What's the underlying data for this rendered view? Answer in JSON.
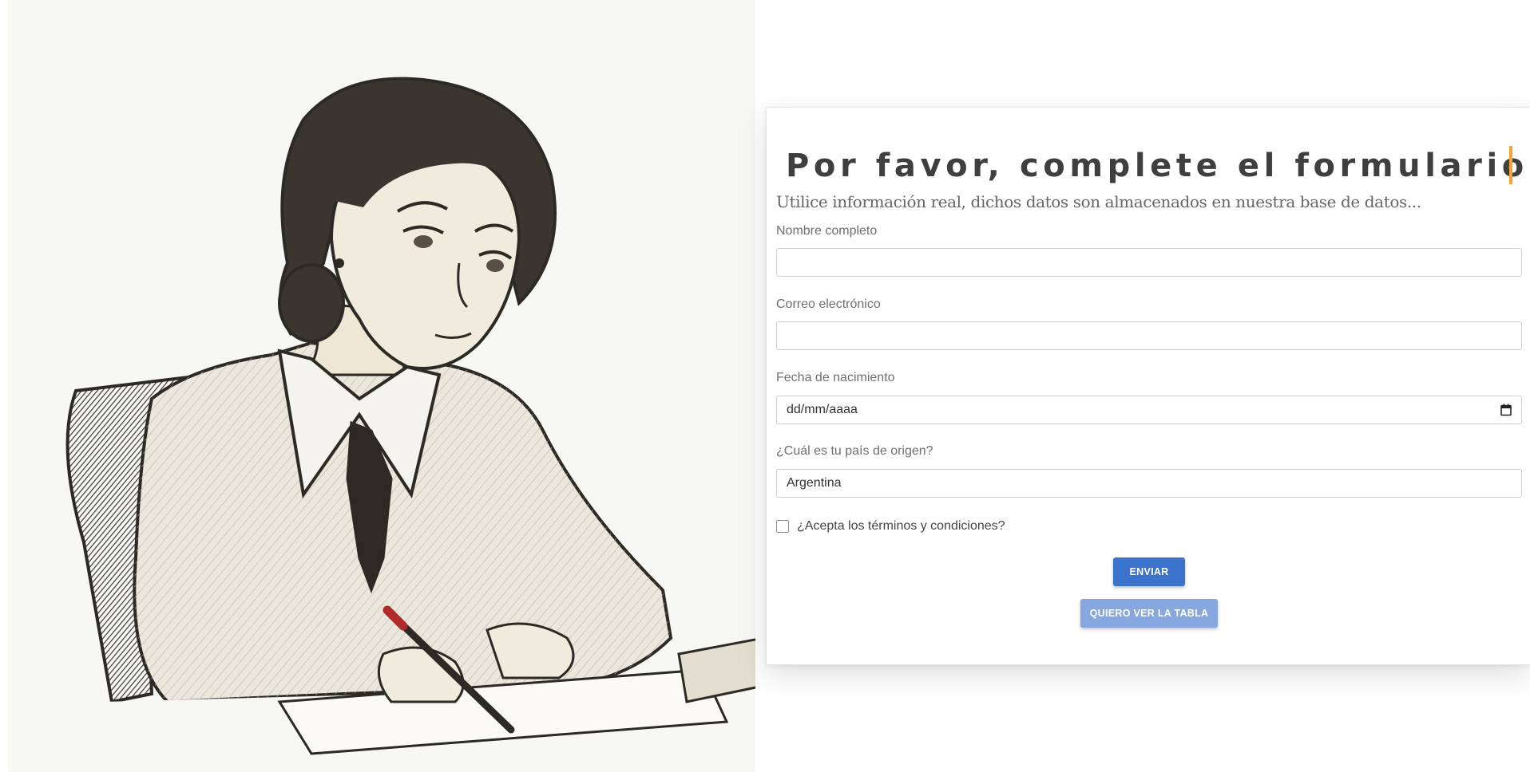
{
  "illustration": {
    "alt": "woman writing at desk"
  },
  "form": {
    "title": "Por favor, complete el formulario.",
    "subtitle": "Utilice información real, dichos datos son almacenados en nuestra base de datos...",
    "fields": {
      "name": {
        "label": "Nombre completo",
        "value": ""
      },
      "email": {
        "label": "Correo electrónico",
        "value": ""
      },
      "birthdate": {
        "label": "Fecha de nacimiento",
        "placeholder": "dd/mm/aaaa"
      },
      "country": {
        "label": "¿Cuál es tu país de origen?",
        "value": "Argentina"
      }
    },
    "terms": {
      "label": "¿Acepta los términos y condiciones?",
      "checked": false
    },
    "buttons": {
      "submit": "ENVIAR",
      "view_table": "QUIERO VER LA TABLA"
    }
  },
  "colors": {
    "primary": "#3b73cc",
    "secondary": "#86a7e0",
    "caret": "#f2a531",
    "title": "#3f3f3f"
  }
}
